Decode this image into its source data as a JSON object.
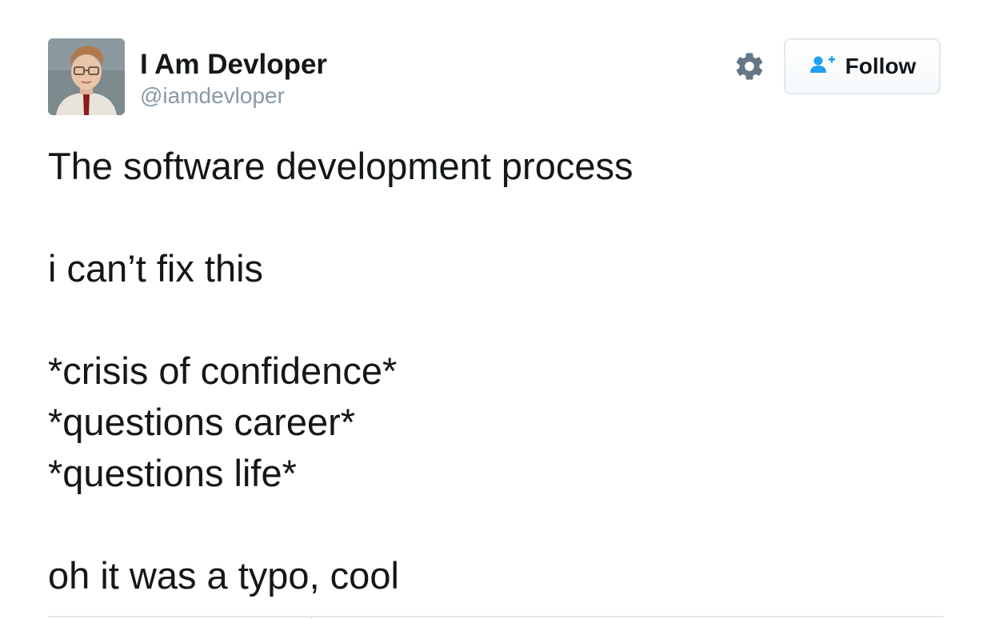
{
  "author": {
    "display_name": "I Am Devloper",
    "handle": "@iamdevloper",
    "avatar_icon": "user-avatar-photo"
  },
  "actions": {
    "settings_icon": "gear-icon",
    "follow_icon": "add-user-icon",
    "follow_label": "Follow"
  },
  "tweet": {
    "lines": [
      "The software development process",
      "",
      "i can’t fix this",
      "",
      "*crisis of confidence*",
      "*questions career*",
      "*questions life*",
      "",
      "oh it was a typo, cool"
    ]
  },
  "colors": {
    "text": "#14171a",
    "muted": "#8899a6",
    "accent": "#1da1f2",
    "border": "#e1e8ed"
  }
}
